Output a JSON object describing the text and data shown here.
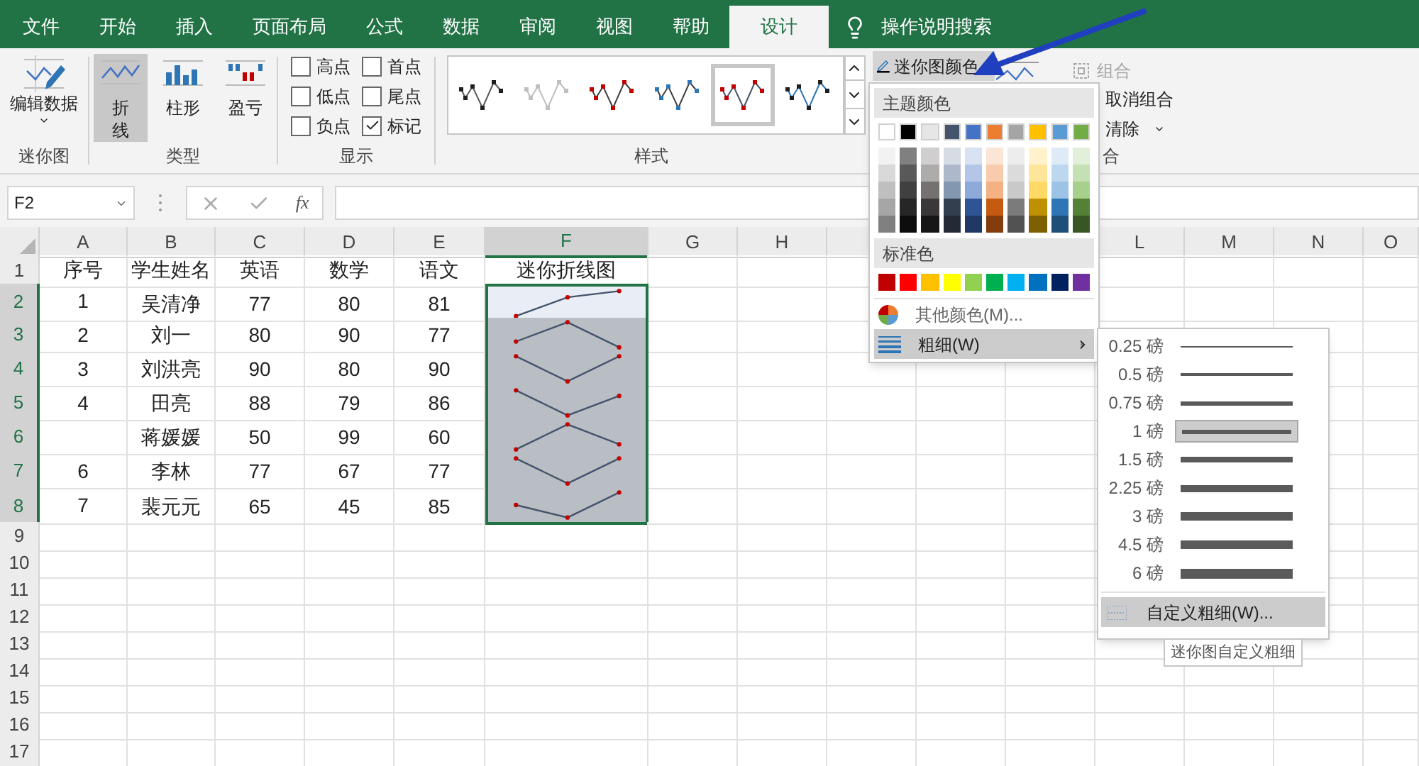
{
  "tabs": [
    {
      "label": "文件",
      "selected": false
    },
    {
      "label": "开始",
      "selected": false
    },
    {
      "label": "插入",
      "selected": false
    },
    {
      "label": "页面布局",
      "selected": false
    },
    {
      "label": "公式",
      "selected": false
    },
    {
      "label": "数据",
      "selected": false
    },
    {
      "label": "审阅",
      "selected": false
    },
    {
      "label": "视图",
      "selected": false
    },
    {
      "label": "帮助",
      "selected": false
    },
    {
      "label": "设计",
      "selected": true
    }
  ],
  "tell_me": "操作说明搜索",
  "ribbon": {
    "sparkline_group": {
      "edit_data": "编辑数据",
      "label": "迷你图"
    },
    "type_group": {
      "label": "类型",
      "types": [
        {
          "label": "折线",
          "kind": "line",
          "selected": true
        },
        {
          "label": "柱形",
          "kind": "column",
          "selected": false
        },
        {
          "label": "盈亏",
          "kind": "winloss",
          "selected": false
        }
      ]
    },
    "show_group": {
      "label": "显示",
      "options": [
        {
          "label": "高点",
          "checked": false
        },
        {
          "label": "首点",
          "checked": false
        },
        {
          "label": "低点",
          "checked": false
        },
        {
          "label": "尾点",
          "checked": false
        },
        {
          "label": "负点",
          "checked": false
        },
        {
          "label": "标记",
          "checked": true
        }
      ]
    },
    "style_group": {
      "label": "样式",
      "styles": [
        {
          "color": "#1f1f1f",
          "line": {
            "color": "#595959"
          },
          "selected": false
        },
        {
          "color": "#bfbfbf",
          "line": {
            "color": "#bfbfbf"
          },
          "selected": false
        },
        {
          "color": "#c00000",
          "line": {
            "color": "#404040"
          },
          "selected": false
        },
        {
          "color": "#2e75b5",
          "line": {
            "color": "#404040"
          },
          "selected": false
        },
        {
          "color": "#c00000",
          "line": {
            "color": "#44546a"
          },
          "selected": true
        },
        {
          "color": "#1f1f1f",
          "line": {
            "color": "#2e75b5"
          },
          "selected": false
        }
      ]
    },
    "color_button": "迷你图颜色",
    "group_items": [
      {
        "label": "组合",
        "disabled": true
      },
      {
        "label": "取消组合",
        "disabled": false
      },
      {
        "label": "清除",
        "disabled": false
      }
    ],
    "group_label": "合"
  },
  "formula_bar": {
    "name_box": "F2",
    "fx": "fx"
  },
  "sheet": {
    "columns": [
      {
        "label": "A",
        "selected": false
      },
      {
        "label": "B",
        "selected": false
      },
      {
        "label": "C",
        "selected": false
      },
      {
        "label": "D",
        "selected": false
      },
      {
        "label": "E",
        "selected": false
      },
      {
        "label": "F",
        "selected": true
      },
      {
        "label": "G",
        "selected": false
      },
      {
        "label": "H",
        "selected": false
      },
      {},
      {},
      {},
      {
        "label": "L",
        "selected": false
      },
      {
        "label": "M",
        "selected": false
      },
      {
        "label": "N",
        "selected": false
      },
      {
        "label": "O",
        "selected": false
      }
    ],
    "row_numbers": [
      {
        "label": "1",
        "selected": false
      },
      {
        "label": "2",
        "selected": true
      },
      {
        "label": "3",
        "selected": true
      },
      {
        "label": "4",
        "selected": true
      },
      {
        "label": "5",
        "selected": true
      },
      {
        "label": "6",
        "selected": true
      },
      {
        "label": "7",
        "selected": true
      },
      {
        "label": "8",
        "selected": true
      },
      {
        "label": "9",
        "selected": false
      },
      {
        "label": "10",
        "selected": false
      },
      {
        "label": "11",
        "selected": false
      },
      {
        "label": "12",
        "selected": false
      },
      {
        "label": "13",
        "selected": false
      },
      {
        "label": "14",
        "selected": false
      },
      {
        "label": "15",
        "selected": false
      },
      {
        "label": "16",
        "selected": false
      },
      {
        "label": "17",
        "selected": false
      }
    ],
    "header": {
      "number": "序号",
      "name": "学生姓名",
      "english": "英语",
      "math": "数学",
      "chinese": "语文",
      "sparkline": "迷你折线图"
    },
    "records": [
      {
        "number": "1",
        "name": "吴清净",
        "english": "77",
        "math": "80",
        "chinese": "81",
        "selected": true,
        "active": true
      },
      {
        "number": "2",
        "name": "刘一",
        "english": "80",
        "math": "90",
        "chinese": "77",
        "selected": true,
        "active": false
      },
      {
        "number": "3",
        "name": "刘洪亮",
        "english": "90",
        "math": "80",
        "chinese": "90",
        "selected": true,
        "active": false
      },
      {
        "number": "4",
        "name": "田亮",
        "english": "88",
        "math": "79",
        "chinese": "86",
        "selected": true,
        "active": false
      },
      {
        "name": "蒋媛媛",
        "english": "50",
        "math": "99",
        "chinese": "60",
        "selected": true,
        "active": false
      },
      {
        "number": "6",
        "name": "李林",
        "english": "77",
        "math": "67",
        "chinese": "77",
        "selected": true,
        "active": false
      },
      {
        "number": "7",
        "name": "裴元元",
        "english": "65",
        "math": "45",
        "chinese": "85",
        "selected": true,
        "active": false
      }
    ]
  },
  "color_menu": {
    "theme_title": "主题颜色",
    "theme_colors": [
      {
        "color": "#ffffff",
        "shades": [
          {
            "color": "#f2f2f2"
          },
          {
            "color": "#d9d9d9"
          },
          {
            "color": "#bfbfbf"
          },
          {
            "color": "#a6a6a6"
          },
          {
            "color": "#808080"
          }
        ]
      },
      {
        "color": "#000000",
        "shades": [
          {
            "color": "#808080"
          },
          {
            "color": "#595959"
          },
          {
            "color": "#404040"
          },
          {
            "color": "#262626"
          },
          {
            "color": "#0d0d0d"
          }
        ]
      },
      {
        "color": "#e7e6e6",
        "shades": [
          {
            "color": "#d0cece"
          },
          {
            "color": "#aeabab"
          },
          {
            "color": "#757171"
          },
          {
            "color": "#3a3838"
          },
          {
            "color": "#171616"
          }
        ]
      },
      {
        "color": "#44546a",
        "shades": [
          {
            "color": "#d6dce4"
          },
          {
            "color": "#adb9ca"
          },
          {
            "color": "#8497b0"
          },
          {
            "color": "#333f4f"
          },
          {
            "color": "#222a35"
          }
        ]
      },
      {
        "color": "#4472c4",
        "shades": [
          {
            "color": "#d9e2f3"
          },
          {
            "color": "#b4c6e7"
          },
          {
            "color": "#8eaadb"
          },
          {
            "color": "#2f5496"
          },
          {
            "color": "#1f3864"
          }
        ]
      },
      {
        "color": "#ed7d31",
        "shades": [
          {
            "color": "#fbe5d5"
          },
          {
            "color": "#f7cbac"
          },
          {
            "color": "#f4b183"
          },
          {
            "color": "#c55a11"
          },
          {
            "color": "#833c0b"
          }
        ]
      },
      {
        "color": "#a5a5a5",
        "shades": [
          {
            "color": "#ededed"
          },
          {
            "color": "#dbdbdb"
          },
          {
            "color": "#c9c9c9"
          },
          {
            "color": "#7b7b7b"
          },
          {
            "color": "#525252"
          }
        ]
      },
      {
        "color": "#ffc000",
        "shades": [
          {
            "color": "#fff2cc"
          },
          {
            "color": "#ffe599"
          },
          {
            "color": "#ffd966"
          },
          {
            "color": "#bf9000"
          },
          {
            "color": "#7f6000"
          }
        ]
      },
      {
        "color": "#5b9bd5",
        "shades": [
          {
            "color": "#deebf6"
          },
          {
            "color": "#bdd7ee"
          },
          {
            "color": "#9cc3e5"
          },
          {
            "color": "#2e75b5"
          },
          {
            "color": "#1f4e79"
          }
        ]
      },
      {
        "color": "#70ad47",
        "shades": [
          {
            "color": "#e2efd9"
          },
          {
            "color": "#c5e0b3"
          },
          {
            "color": "#a8d08d"
          },
          {
            "color": "#538135"
          },
          {
            "color": "#375623"
          }
        ]
      }
    ],
    "standard_title": "标准色",
    "standard_colors": [
      {
        "color": "#c00000"
      },
      {
        "color": "#ff0000"
      },
      {
        "color": "#ffc000"
      },
      {
        "color": "#ffff00"
      },
      {
        "color": "#92d050"
      },
      {
        "color": "#00b050"
      },
      {
        "color": "#00b0f0"
      },
      {
        "color": "#0070c0"
      },
      {
        "color": "#002060"
      },
      {
        "color": "#7030a0"
      }
    ],
    "more_colors": "其他颜色(M)...",
    "weight": {
      "label": "粗细(W)",
      "selected": true
    }
  },
  "weight_menu": {
    "items": [
      {
        "label": "0.25 磅",
        "selected": false
      },
      {
        "label": "0.5 磅",
        "selected": false
      },
      {
        "label": "0.75 磅",
        "selected": false
      },
      {
        "label": "1 磅",
        "selected": true
      },
      {
        "label": "1.5 磅",
        "selected": false
      },
      {
        "label": "2.25 磅",
        "selected": false
      },
      {
        "label": "3 磅",
        "selected": false
      },
      {
        "label": "4.5 磅",
        "selected": false
      },
      {
        "label": "6 磅",
        "selected": false
      }
    ],
    "custom": {
      "label": "自定义粗细(W)...",
      "selected": true
    },
    "tooltip": "迷你图自定义粗细"
  }
}
